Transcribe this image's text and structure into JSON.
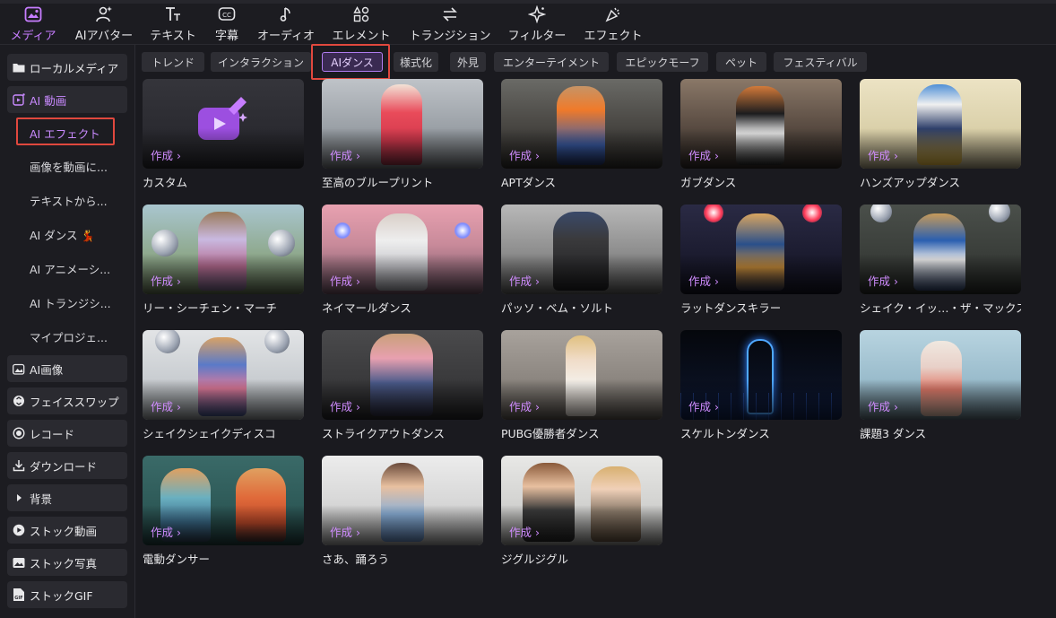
{
  "toolbar": {
    "items": [
      {
        "label": "メディア",
        "icon": "media-icon"
      },
      {
        "label": "AIアバター",
        "icon": "ai-avatar-icon"
      },
      {
        "label": "テキスト",
        "icon": "text-icon"
      },
      {
        "label": "字幕",
        "icon": "caption-icon"
      },
      {
        "label": "オーディオ",
        "icon": "music-note-icon"
      },
      {
        "label": "エレメント",
        "icon": "element-icon"
      },
      {
        "label": "トランジション",
        "icon": "transition-icon"
      },
      {
        "label": "フィルター",
        "icon": "filter-icon"
      },
      {
        "label": "エフェクト",
        "icon": "effect-icon"
      }
    ],
    "active_index": 0
  },
  "sidebar": {
    "items": [
      {
        "label": "ローカルメディア",
        "icon": "folder-icon"
      },
      {
        "label": "AI 動画",
        "icon": "ai-video-icon"
      },
      {
        "label": "AI画像",
        "icon": "ai-image-icon"
      },
      {
        "label": "フェイススワップ",
        "icon": "face-swap-icon"
      },
      {
        "label": "レコード",
        "icon": "record-icon"
      },
      {
        "label": "ダウンロード",
        "icon": "download-icon"
      },
      {
        "label": "背景",
        "icon": "caret-right-icon"
      },
      {
        "label": "ストック動画",
        "icon": "play-circle-icon"
      },
      {
        "label": "ストック写真",
        "icon": "photo-icon"
      },
      {
        "label": "ストックGIF",
        "icon": "gif-icon"
      }
    ],
    "ai_video_sub": [
      {
        "label": "AI エフェクト"
      },
      {
        "label": "画像を動画に..."
      },
      {
        "label": "テキストから..."
      },
      {
        "label": "AI ダンス 💃"
      },
      {
        "label": "AI アニメーシ..."
      },
      {
        "label": "AI トランジシ..."
      },
      {
        "label": "マイプロジェ..."
      }
    ]
  },
  "filters": [
    "トレンド",
    "インタラクション",
    "AIダンス",
    "様式化",
    "外見",
    "エンターテイメント",
    "エピックモーフ",
    "ペット",
    "フェスティバル"
  ],
  "active_filter": "AIダンス",
  "create_label": "作成 ›",
  "cards": [
    {
      "title": "カスタム"
    },
    {
      "title": "至高のブループリント"
    },
    {
      "title": "APTダンス"
    },
    {
      "title": "ガブダンス"
    },
    {
      "title": "ハンズアップダンス"
    },
    {
      "title": "リー・シーチェン・マーチ"
    },
    {
      "title": "ネイマールダンス"
    },
    {
      "title": "パッソ・ベム・ソルト"
    },
    {
      "title": "ラットダンスキラー"
    },
    {
      "title": "シェイク・イッ…・ザ・マックス"
    },
    {
      "title": "シェイクシェイクディスコ"
    },
    {
      "title": "ストライクアウトダンス"
    },
    {
      "title": "PUBG優勝者ダンス"
    },
    {
      "title": "スケルトンダンス"
    },
    {
      "title": "課題3 ダンス"
    },
    {
      "title": "電動ダンサー"
    },
    {
      "title": "さあ、踊ろう"
    },
    {
      "title": "ジグルジグル"
    }
  ],
  "colors": {
    "accent": "#c77dff",
    "highlight_box": "#e0483e",
    "background": "#1a1a1f"
  }
}
